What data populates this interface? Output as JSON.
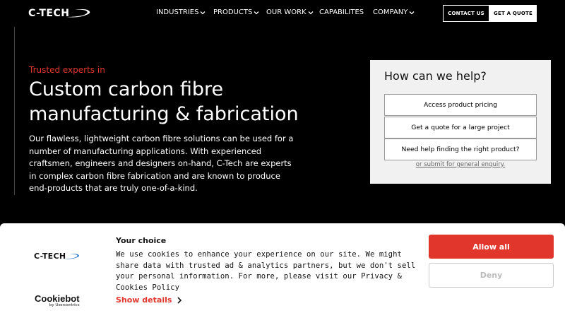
{
  "header": {
    "logo_text": "C-TECH",
    "nav": [
      {
        "label": "INDUSTRIES",
        "has_dropdown": true
      },
      {
        "label": "PRODUCTS",
        "has_dropdown": true
      },
      {
        "label": "OUR WORK",
        "has_dropdown": true
      },
      {
        "label": "CAPABILITES",
        "has_dropdown": false
      },
      {
        "label": "COMPANY",
        "has_dropdown": true
      }
    ],
    "contact_label": "CONTACT US",
    "quote_label": "GET A QUOTE"
  },
  "hero": {
    "kicker": "Trusted experts in",
    "title": "Custom carbon fibre manufacturing & fabrication",
    "body": "Our flawless, lightweight carbon fibre solutions can be used for a number of manufacturing applications. With experienced craftsmen, engineers and designers on-hand, C-Tech are experts in complex carbon fibre fabrication and are known to produce end-products that are truly one-of-a-kind."
  },
  "help_box": {
    "title": "How can we help?",
    "buttons": [
      "Access product pricing",
      "Get a quote for a large project",
      "Need help finding the right product?"
    ],
    "link": "or submit for general enquiry."
  },
  "cookie_banner": {
    "logo_text": "C-TECH",
    "provider": "Cookiebot",
    "provider_sub": "by Usercentrics",
    "title": "Your choice",
    "body": "We use cookies to enhance your experience on our site. We might share data with trusted ad & analytics partners, but we don't sell your personal information. For more, please visit our Privacy & Cookies Policy",
    "details_label": "Show details",
    "allow_label": "Allow all",
    "deny_label": "Deny"
  },
  "colors": {
    "accent": "#e1362c",
    "background": "#000000",
    "help_box_bg": "#f1f1f1"
  }
}
